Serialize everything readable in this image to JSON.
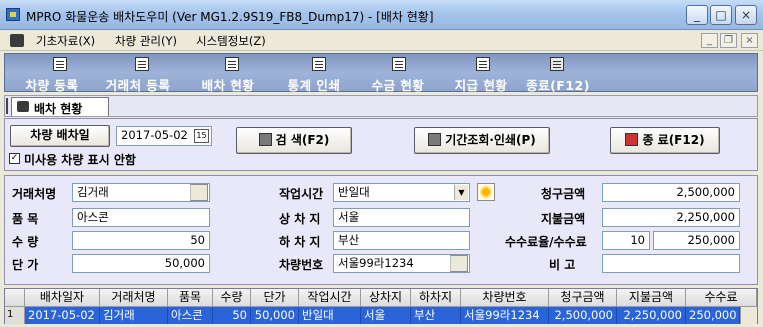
{
  "window": {
    "title": "MPRO 화물운송 배차도우미 (Ver MG1.2.9S19_FB8_Dump17) - [배차 현황]",
    "controls": {
      "minimize": "_",
      "maximize": "□",
      "close": "×"
    }
  },
  "menubar": {
    "items": [
      "기초자료(X)",
      "차량 관리(Y)",
      "시스템정보(Z)"
    ],
    "mdi_controls": {
      "minimize": "_",
      "restore": "❐",
      "close": "×"
    }
  },
  "toolbar": {
    "items": [
      "차량 등록",
      "거래처 등록",
      "배차 현황",
      "통계 인쇄",
      "수금 현황",
      "지급 현황",
      "종료(F12)"
    ]
  },
  "subtab": {
    "label": "배차 현황"
  },
  "filter": {
    "date_button": "차량 배차일",
    "date_value": "2017-05-02",
    "calendar_glyph": "15",
    "search_button": "검 색(F2)",
    "print_button": "기간조회·인쇄(P)",
    "exit_button": "종 료(F12)",
    "checkbox_checked": true,
    "checkbox_mark": "✓",
    "checkbox_label": "미사용 차량 표시 안함"
  },
  "form": {
    "client_label": "거래처명",
    "client_value": "김거래",
    "item_label": "품   목",
    "item_value": "아스콘",
    "qty_label": "수   량",
    "qty_value": "50",
    "price_label": "단   가",
    "price_value": "50,000",
    "worktime_label": "작업시간",
    "worktime_value": "반일대",
    "loading_label": "상 차 지",
    "loading_value": "서울",
    "unloading_label": "하 차 지",
    "unloading_value": "부산",
    "vehicle_label": "차량번호",
    "vehicle_value": "서울99라1234",
    "billing_label": "청구금액",
    "billing_value": "2,500,000",
    "payment_label": "지불금액",
    "payment_value": "2,250,000",
    "fee_label": "수수료율/수수료",
    "fee_rate_value": "10",
    "fee_value": "250,000",
    "memo_label": "비   고",
    "memo_value": ""
  },
  "grid": {
    "columns": [
      "배차일자",
      "거래처명",
      "품목",
      "수량",
      "단가",
      "작업시간",
      "상차지",
      "하차지",
      "차량번호",
      "청구금액",
      "지불금액",
      "수수료"
    ],
    "row_indicator": "1 ▶",
    "rows": [
      [
        "2017-05-02",
        "김거래",
        "아스콘",
        "50",
        "50,000",
        "반일대",
        "서울",
        "부산",
        "서울99라1234",
        "2,500,000",
        "2,250,000",
        "250,000"
      ]
    ]
  }
}
